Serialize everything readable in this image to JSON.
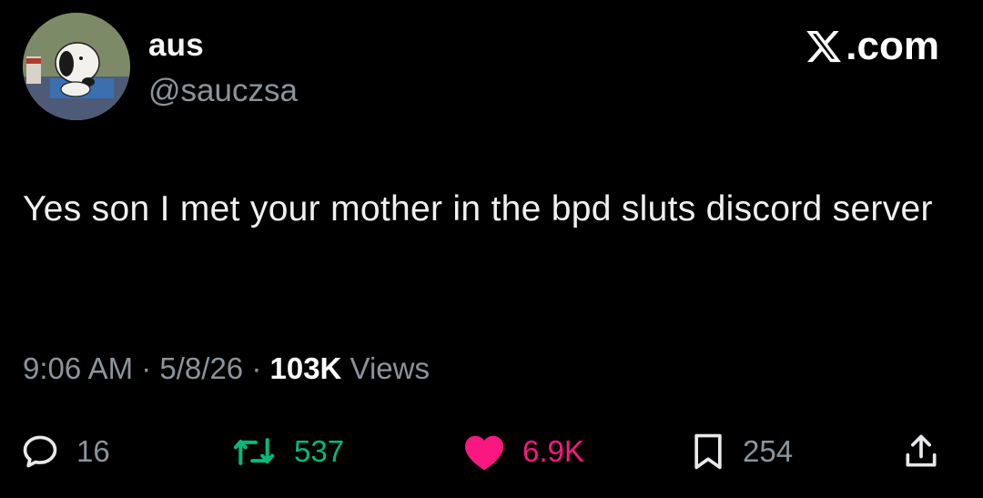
{
  "author": {
    "name": "aus",
    "handle": "@sauczsa",
    "avatar_icon": "snoopy-avatar-icon"
  },
  "brand": {
    "label": ".com",
    "logo_icon": "x-logo-icon"
  },
  "tweet": {
    "text": "Yes son I met your mother in the bpd sluts discord server"
  },
  "meta": {
    "time": "9:06 AM",
    "sep1": " · ",
    "date": "5/8/26",
    "sep2": " · ",
    "views_count": "103K",
    "views_label": " Views"
  },
  "actions": {
    "replies": "16",
    "reposts": "537",
    "likes": "6.9K",
    "bookmarks": "254"
  },
  "colors": {
    "background": "#000000",
    "secondary_text": "#8b949c",
    "like": "#f91880",
    "repost": "#00ba7c"
  }
}
